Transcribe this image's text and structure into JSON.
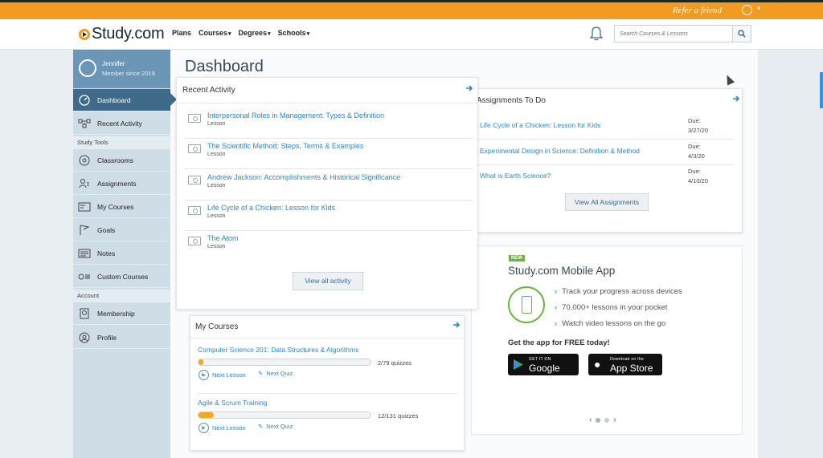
{
  "topbar": {
    "refer_label": "Refer a friend"
  },
  "nav": {
    "logo": "Study.com",
    "links": [
      {
        "label": "Plans",
        "caret": ""
      },
      {
        "label": "Courses",
        "caret": "▾"
      },
      {
        "label": "Degrees",
        "caret": "▾"
      },
      {
        "label": "Schools",
        "caret": "▾"
      }
    ],
    "search_placeholder": "Search Courses & Lessons"
  },
  "sidebar": {
    "user_name": "Jennifer",
    "member_since": "Member since 2019",
    "items": [
      {
        "label": "Dashboard",
        "icon": "dashboard-icon"
      },
      {
        "label": "Recent Activity",
        "icon": "activity-icon"
      }
    ],
    "study_tools_label": "Study Tools",
    "tools": [
      {
        "label": "Classrooms",
        "icon": "classrooms-icon"
      },
      {
        "label": "Assignments",
        "icon": "assignments-icon"
      },
      {
        "label": "My Courses",
        "icon": "courses-icon"
      },
      {
        "label": "Goals",
        "icon": "goals-icon"
      },
      {
        "label": "Notes",
        "icon": "notes-icon"
      },
      {
        "label": "Custom Courses",
        "icon": "custom-courses-icon"
      }
    ],
    "account_label": "Account",
    "account_items": [
      {
        "label": "Membership",
        "icon": "membership-icon"
      },
      {
        "label": "Profile",
        "icon": "profile-icon"
      }
    ]
  },
  "dashboard": {
    "title": "Dashboard"
  },
  "recent_activity": {
    "title": "Recent Activity",
    "items": [
      {
        "title": "Interpersonal Roles in Management: Types & Definition",
        "type": "Lesson"
      },
      {
        "title": "The Scientific Method: Steps, Terms & Examples",
        "type": "Lesson"
      },
      {
        "title": "Andrew Jackson: Accomplishments & Historical Significance",
        "type": "Lesson"
      },
      {
        "title": "Life Cycle of a Chicken: Lesson for Kids",
        "type": "Lesson"
      },
      {
        "title": "The Atom",
        "type": "Lesson"
      }
    ],
    "view_all": "View all activity"
  },
  "assignments": {
    "title": "Assignments To Do",
    "items": [
      {
        "title": "Life Cycle of a Chicken: Lesson for Kids",
        "due_label": "Due:",
        "date": "3/27/20"
      },
      {
        "title": "Experimental Design in Science: Definition & Method",
        "due_label": "Due:",
        "date": "4/3/20"
      },
      {
        "title": "What is Earth Science?",
        "due_label": "Due:",
        "date": "4/10/20"
      }
    ],
    "view_all": "View All Assignments"
  },
  "my_courses": {
    "title": "My Courses",
    "courses": [
      {
        "title": "Computer Science 201: Data Structures & Algorithms",
        "progress_text": "2/79 quizzes",
        "progress": 0.025,
        "next_lesson": "Next Lesson",
        "next_quiz": "Next Quiz"
      },
      {
        "title": "Agile & Scrum Training",
        "progress_text": "12/131 quizzes",
        "progress": 0.09,
        "next_lesson": "Next Lesson",
        "next_quiz": "Next Quiz"
      }
    ]
  },
  "mobile_app": {
    "badge": "NEW",
    "title": "Study.com Mobile App",
    "bullets": [
      "Track your progress across devices",
      "70,000+ lessons in your pocket",
      "Watch video lessons on the go"
    ],
    "get_app": "Get the app for FREE today!",
    "google_small": "GET IT ON",
    "google_big": "Google Play",
    "apple_small": "Download on the",
    "apple_big": "App Store"
  },
  "colors": {
    "accent_orange": "#f29b22",
    "sidebar_active": "#3f6a89",
    "link_blue": "#2f86c3",
    "green": "#6bb33f"
  }
}
